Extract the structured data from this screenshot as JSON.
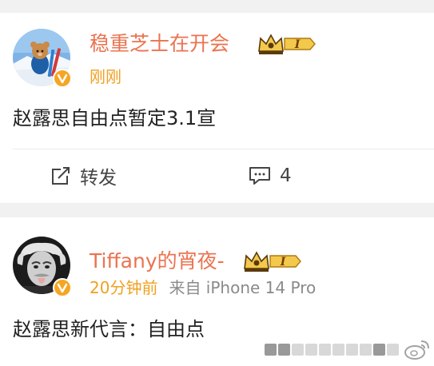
{
  "posts": [
    {
      "author_name": "稳重芝士在开会",
      "time": "刚刚",
      "source": "",
      "content": "赵露思自由点暂定3.1宣",
      "actions": {
        "repost_label": "转发",
        "comment_count": "4"
      },
      "badge_level": "I"
    },
    {
      "author_name": "Tiffany的宵夜-",
      "time": "20分钟前",
      "source": "来自 iPhone 14 Pro",
      "content": "赵露思新代言：自由点",
      "badge_level": "I"
    }
  ],
  "colors": {
    "author_name": "#eb7350",
    "time": "#f0a020",
    "verified_badge": "#f5a623",
    "section_gap": "#f1f1f1"
  },
  "icons": {
    "verified": "verified-icon",
    "crown": "crown-badge-icon",
    "repost": "repost-icon",
    "comment": "comment-icon",
    "watermark": "weibo-logo-icon"
  }
}
